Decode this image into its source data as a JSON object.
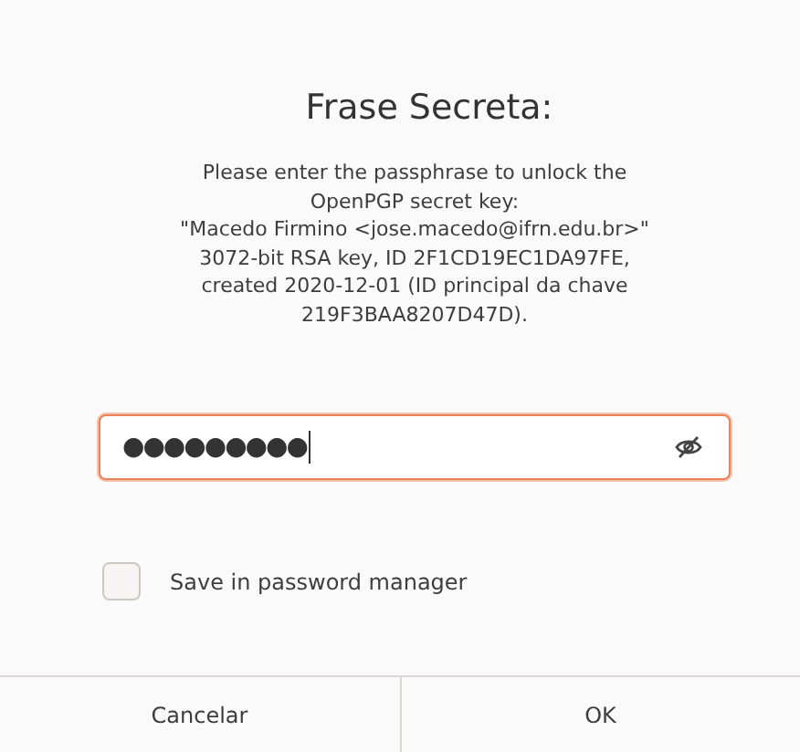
{
  "dialog": {
    "title": "Frase Secreta:",
    "message": "Please enter the passphrase to unlock the\nOpenPGP secret key:\n\"Macedo Firmino <jose.macedo@ifrn.edu.br>\"\n3072-bit RSA key, ID 2F1CD19EC1DA97FE,\ncreated 2020-12-01 (ID principal da chave\n219F3BAA8207D47D).",
    "passphrase_field": {
      "value": "●●●●●●●●●",
      "focused": true
    },
    "save_in_password_manager": {
      "label": "Save in password manager",
      "checked": false
    },
    "buttons": [
      {
        "label": "Cancelar"
      },
      {
        "label": "OK"
      }
    ]
  }
}
